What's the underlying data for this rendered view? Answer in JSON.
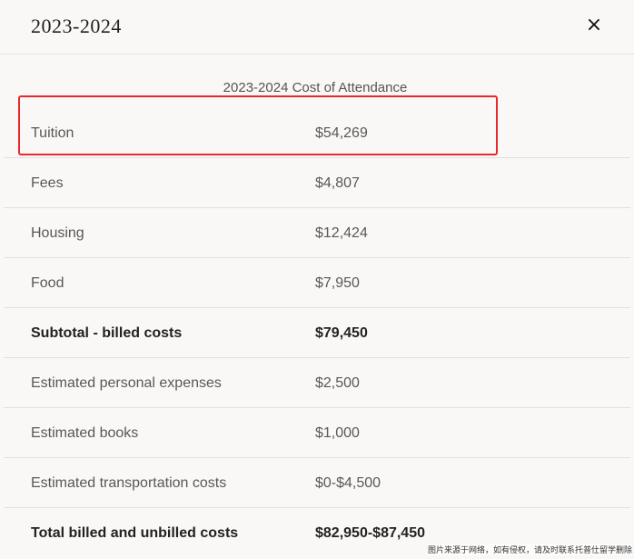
{
  "header": {
    "title": "2023-2024",
    "close_symbol": "×"
  },
  "table": {
    "caption": "2023-2024 Cost of Attendance",
    "rows": [
      {
        "label": "Tuition",
        "value": "$54,269"
      },
      {
        "label": "Fees",
        "value": "$4,807"
      },
      {
        "label": "Housing",
        "value": "$12,424"
      },
      {
        "label": "Food",
        "value": "$7,950"
      },
      {
        "label": "Subtotal - billed costs",
        "value": "$79,450"
      },
      {
        "label": "Estimated personal expenses",
        "value": "$2,500"
      },
      {
        "label": "Estimated books",
        "value": "$1,000"
      },
      {
        "label": "Estimated transportation costs",
        "value": "$0-$4,500"
      },
      {
        "label": "Total billed and unbilled costs",
        "value": "$82,950-$87,450"
      }
    ]
  },
  "annotation": {
    "highlight_color": "#e8282b"
  },
  "watermark": {
    "text": "图片来源于网络，如有侵权，请及时联系托普仕留学删除"
  }
}
